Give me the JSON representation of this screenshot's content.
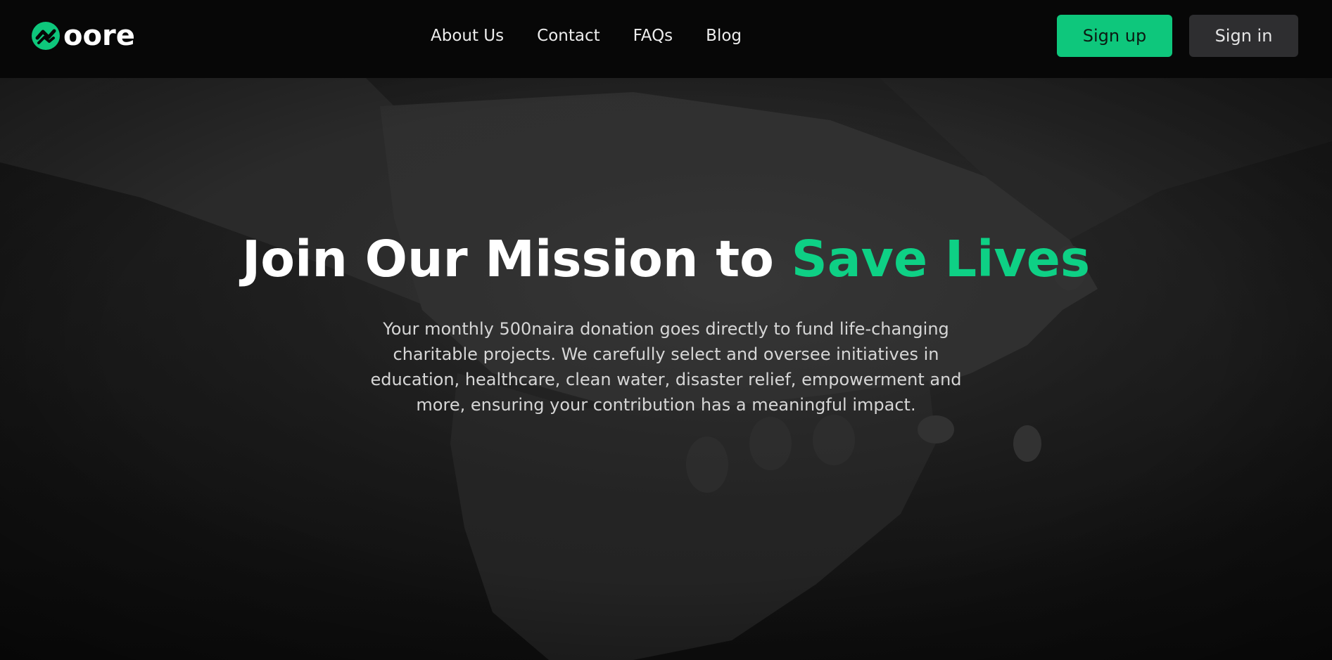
{
  "brand": {
    "name": "oore",
    "logo_icon": "oore-logo-mark",
    "accent_color": "#0ec77c"
  },
  "nav": {
    "items": [
      {
        "label": "About Us"
      },
      {
        "label": "Contact"
      },
      {
        "label": "FAQs"
      },
      {
        "label": "Blog"
      }
    ]
  },
  "auth": {
    "signup_label": "Sign up",
    "signin_label": "Sign in"
  },
  "hero": {
    "title_prefix": "Join Our Mission to ",
    "title_accent": "Save Lives",
    "description": "Your monthly 500naira donation goes directly to fund life-changing charitable projects. We carefully select and oversee initiatives in education, healthcare, clean water, disaster relief, empowerment and more, ensuring your contribution has a meaningful impact.",
    "background_image": "clasped-hands-photo"
  }
}
